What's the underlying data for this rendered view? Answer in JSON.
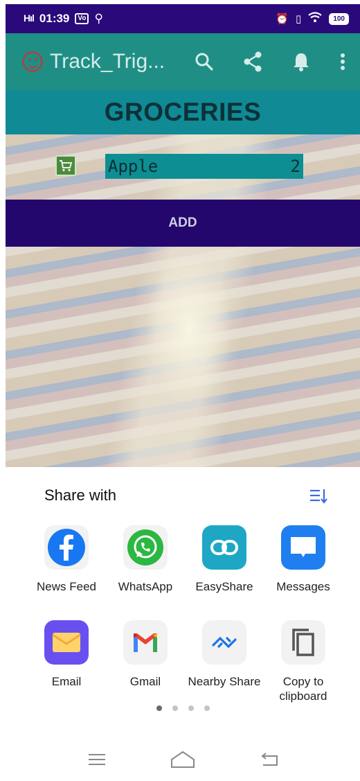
{
  "status_bar": {
    "signal": "H  ıl",
    "time": "01:39",
    "volte": "Vo",
    "battery": "100"
  },
  "app_bar": {
    "title": "Track_Trig..."
  },
  "section": {
    "title": "GROCERIES"
  },
  "item": {
    "name": "Apple",
    "quantity": "2"
  },
  "add_button": {
    "label": "ADD"
  },
  "share_sheet": {
    "title": "Share with",
    "targets": [
      {
        "label": "News Feed",
        "icon": "facebook-icon"
      },
      {
        "label": "WhatsApp",
        "icon": "whatsapp-icon"
      },
      {
        "label": "EasyShare",
        "icon": "easyshare-icon"
      },
      {
        "label": "Messages",
        "icon": "messages-icon"
      },
      {
        "label": "Email",
        "icon": "email-icon"
      },
      {
        "label": "Gmail",
        "icon": "gmail-icon"
      },
      {
        "label": "Nearby Share",
        "icon": "nearby-share-icon"
      },
      {
        "label": "Copy to\nclipboard",
        "icon": "copy-icon"
      }
    ],
    "page_count": 4,
    "active_page": 1
  },
  "colors": {
    "status_bar": "#2a0a7a",
    "app_bar": "#1f8f85",
    "section_header": "#108a94",
    "add_button": "#24076c",
    "accent": "#3f6ae0"
  }
}
